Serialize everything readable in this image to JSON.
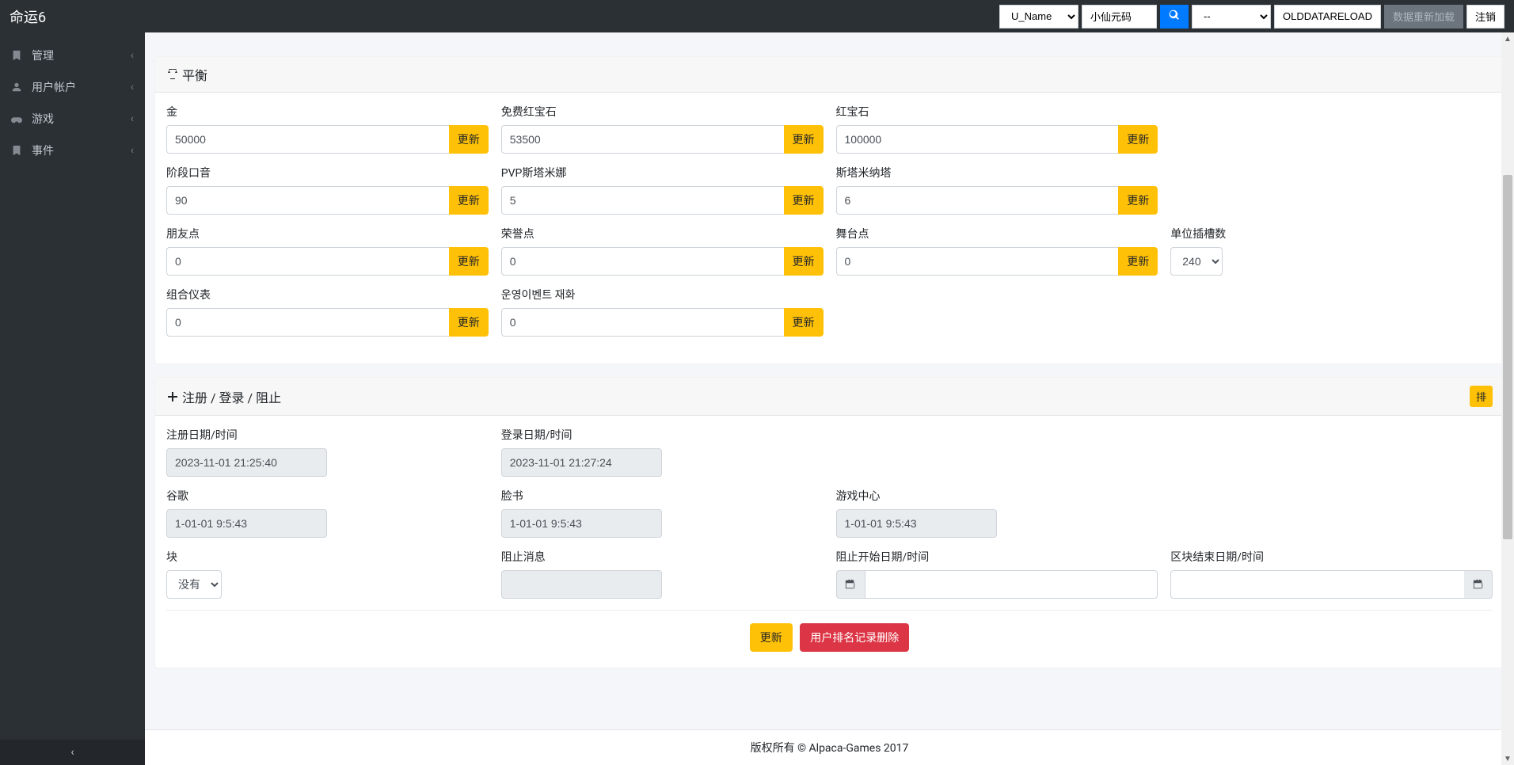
{
  "topbar": {
    "brand": "命运6",
    "filter_select": "U_Name",
    "search_value": "小仙元码",
    "secondary_select": "--",
    "olddata_label": "OLDDATARELOAD",
    "disabled_label": "数据重新加载",
    "logout_label": "注销"
  },
  "sidebar": {
    "items": [
      {
        "label": "管理"
      },
      {
        "label": "用户帐户"
      },
      {
        "label": "游戏"
      },
      {
        "label": "事件"
      }
    ]
  },
  "balance": {
    "title": "平衡",
    "update_label": "更新",
    "fields": {
      "gold": {
        "label": "金",
        "value": "50000"
      },
      "free_ruby": {
        "label": "免费红宝石",
        "value": "53500"
      },
      "ruby": {
        "label": "红宝石",
        "value": "100000"
      },
      "stage_accent": {
        "label": "阶段口音",
        "value": "90"
      },
      "pvp_stamina": {
        "label": "PVP斯塔米娜",
        "value": "5"
      },
      "stamina": {
        "label": "斯塔米纳塔",
        "value": "6"
      },
      "friend_point": {
        "label": "朋友点",
        "value": "0"
      },
      "honor_point": {
        "label": "荣誉点",
        "value": "0"
      },
      "stage_point": {
        "label": "舞台点",
        "value": "0"
      },
      "slot_count": {
        "label": "单位插槽数",
        "value": "240"
      },
      "combo_meter": {
        "label": "组合仪表",
        "value": "0"
      },
      "ops_event": {
        "label": "운영이벤트 재화",
        "value": "0"
      }
    }
  },
  "register": {
    "title": "注册 / 登录 / 阻止",
    "badge": "排",
    "fields": {
      "reg_date": {
        "label": "注册日期/时间",
        "value": "2023-11-01 21:25:40"
      },
      "login_date": {
        "label": "登录日期/时间",
        "value": "2023-11-01 21:27:24"
      },
      "google": {
        "label": "谷歌",
        "value": "1-01-01 9:5:43"
      },
      "facebook": {
        "label": "脸书",
        "value": "1-01-01 9:5:43"
      },
      "gamecenter": {
        "label": "游戏中心",
        "value": "1-01-01 9:5:43"
      },
      "block": {
        "label": "块",
        "value": "没有"
      },
      "block_msg": {
        "label": "阻止消息",
        "value": ""
      },
      "block_start": {
        "label": "阻止开始日期/时间",
        "value": ""
      },
      "block_end": {
        "label": "区块结束日期/时间",
        "value": ""
      }
    },
    "update_label": "更新",
    "delete_label": "用户排名记录删除"
  },
  "footer": "版权所有 © Alpaca-Games 2017"
}
